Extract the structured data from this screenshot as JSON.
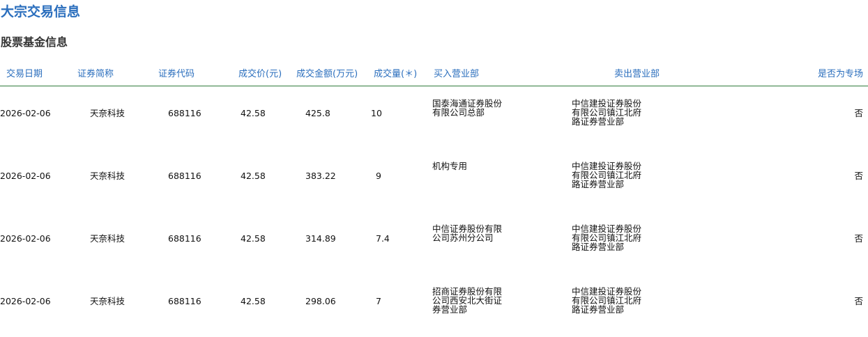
{
  "page_title": "大宗交易信息",
  "section_title": "股票基金信息",
  "columns": [
    "交易日期",
    "证券简称",
    "证券代码",
    "成交价(元)",
    "成交金额(万元)",
    "成交量(＊)",
    "买入营业部",
    "卖出营业部",
    "是否为专场"
  ],
  "rows": [
    {
      "date": "2026-02-06",
      "name": "天奈科技",
      "code": "688116",
      "price": "42.58",
      "amount": "425.8",
      "volume": "10",
      "buyer": [
        "国泰海通证券股份",
        "有限公司总部"
      ],
      "seller": [
        "中信建投证券股份",
        "有限公司镇江北府",
        "路证券营业部"
      ],
      "special": "否"
    },
    {
      "date": "2026-02-06",
      "name": "天奈科技",
      "code": "688116",
      "price": "42.58",
      "amount": "383.22",
      "volume": "9",
      "buyer": [
        "机构专用"
      ],
      "seller": [
        "中信建投证券股份",
        "有限公司镇江北府",
        "路证券营业部"
      ],
      "special": "否"
    },
    {
      "date": "2026-02-06",
      "name": "天奈科技",
      "code": "688116",
      "price": "42.58",
      "amount": "314.89",
      "volume": "7.4",
      "buyer": [
        "中信证券股份有限",
        "公司苏州分公司"
      ],
      "seller": [
        "中信建投证券股份",
        "有限公司镇江北府",
        "路证券营业部"
      ],
      "special": "否"
    },
    {
      "date": "2026-02-06",
      "name": "天奈科技",
      "code": "688116",
      "price": "42.58",
      "amount": "298.06",
      "volume": "7",
      "buyer": [
        "招商证券股份有限",
        "公司西安北大街证",
        "券营业部"
      ],
      "seller": [
        "中信建投证券股份",
        "有限公司镇江北府",
        "路证券营业部"
      ],
      "special": "否"
    }
  ]
}
